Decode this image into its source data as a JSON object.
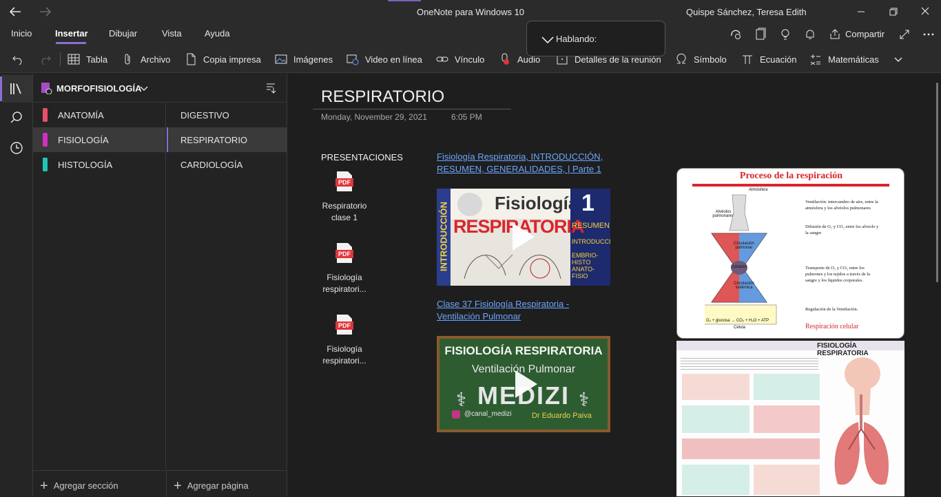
{
  "window": {
    "title": "OneNote para Windows 10",
    "user": "Quispe Sánchez, Teresa Edith"
  },
  "menu": {
    "tabs": [
      "Inicio",
      "Insertar",
      "Dibujar",
      "Vista",
      "Ayuda"
    ],
    "active_tab": "Insertar",
    "share_label": "Compartir"
  },
  "ribbon": {
    "items": [
      "Tabla",
      "Archivo",
      "Copia impresa",
      "Imágenes",
      "Video en línea",
      "Vínculo",
      "Audio",
      "Detalles de la reunión",
      "Símbolo",
      "Ecuación",
      "Matemáticas"
    ]
  },
  "speaking_popup": {
    "label": "Hablando:"
  },
  "notebook": {
    "name": "MORFOFISIOLOGÍA",
    "sections": [
      {
        "label": "ANATOMÍA",
        "color": "#e8506a"
      },
      {
        "label": "FISIOLOGÍA",
        "color": "#d12ec4"
      },
      {
        "label": "HISTOLOGÍA",
        "color": "#23c4b4"
      }
    ],
    "selected_section": "FISIOLOGÍA",
    "pages": [
      "DIGESTIVO",
      "RESPIRATORIO",
      "CARDIOLOGÍA"
    ],
    "selected_page": "RESPIRATORIO",
    "add_section": "Agregar sección",
    "add_page": "Agregar página"
  },
  "page": {
    "title": "RESPIRATORIO",
    "date": "Monday, November 29, 2021",
    "time": "6:05 PM",
    "presentations_label": "PRESENTACIONES",
    "attachments": [
      {
        "name_line1": "Respiratorio",
        "name_line2": "clase 1"
      },
      {
        "name_line1": "Fisiología",
        "name_line2": "respiratori..."
      },
      {
        "name_line1": "Fisiología",
        "name_line2": "respiratori..."
      }
    ],
    "pdf_badge": "PDF",
    "videos": [
      {
        "link_line1": "Fisiología Respiratoria, INTRODUCCIÓN,",
        "link_line2": "RESUMEN, GENERALIDADES, | Parte 1",
        "thumb_text": {
          "big": "Fisiología",
          "main": "RESPIRATORIA",
          "side": "INTRODUCCIÓN",
          "num": "1",
          "r1": "RESUMEN",
          "r2": "INTRODUCCIÓN",
          "r3": "EMBRIO-HISTO",
          "r4": "ANATO- FISIO"
        }
      },
      {
        "link_line1": "Clase 37 Fisiología Respiratoria -",
        "link_line2": "Ventilación Pulmonar",
        "thumb_text": {
          "t1": "FISIOLOGÍA RESPIRATORIA",
          "t2": "Ventilación Pulmonar",
          "t3": "MEDIZI",
          "handle": "@canal_medizi",
          "author": "Dr Eduardo Paiva"
        }
      }
    ],
    "infographic1": {
      "title": "Proceso de la respiración",
      "atm": "Atmósfera",
      "alv": "Alvéolos pulmonares",
      "circ_pul": "Circulación pulmonar",
      "corazon": "Corazón",
      "circ_sis": "Circulación sistémica",
      "celula": "Célula",
      "eq": "O₂ + glucosa → CO₂ + H₂O + ATP",
      "steps": [
        "Ventilación: intercambio de aire, entre la atmósfera y los alvéolos pulmonares",
        "Difusión de O₂ y CO₂ entre los alveolo y la sangre",
        "Transporte de O₂ y CO₂ entre los pulmones y los tejidos a través de la sangre y los líquidos corporales.",
        "Regulación de la Ventilación."
      ],
      "footer": "Respiración celular"
    },
    "infographic2": {
      "title": "FISIOLOGÍA RESPIRATORIA"
    }
  }
}
